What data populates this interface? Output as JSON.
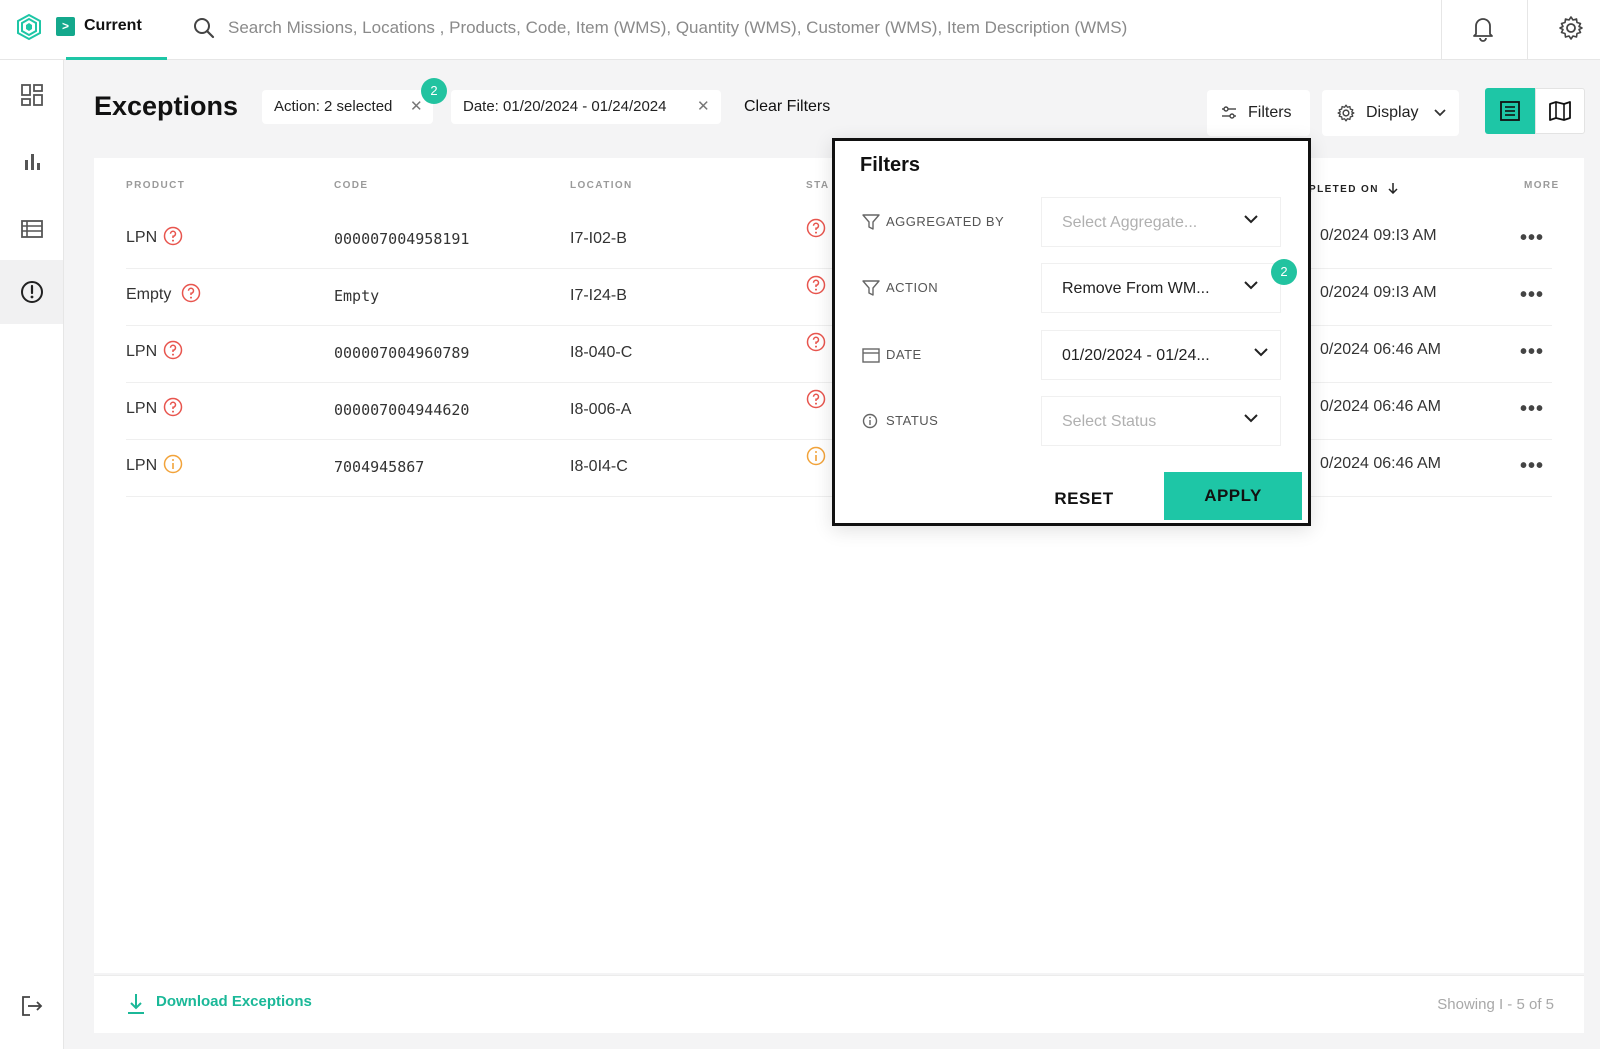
{
  "topbar": {
    "current_tab": "Current",
    "search_placeholder": "Search Missions, Locations , Products, Code, Item (WMS), Quantity (WMS), Customer (WMS), Item Description (WMS)"
  },
  "sidebar": {
    "items": [
      {
        "name": "dashboard",
        "icon": "grid-icon"
      },
      {
        "name": "analytics",
        "icon": "bar-chart-icon"
      },
      {
        "name": "list",
        "icon": "table-icon"
      },
      {
        "name": "exceptions",
        "icon": "alert-circle-icon",
        "active": true
      }
    ],
    "bottom_icon": "logout-icon"
  },
  "page": {
    "title": "Exceptions",
    "chips": [
      {
        "label": "Action: 2 selected",
        "badge": "2"
      },
      {
        "label": "Date: 01/20/2024 - 01/24/2024"
      }
    ],
    "clear_filters": "Clear Filters",
    "filters_button": "Filters",
    "display_button": "Display"
  },
  "table": {
    "columns": {
      "product": "PRODUCT",
      "code": "CODE",
      "location": "LOCATION",
      "status": "STA",
      "completed_on": "PLETED ON",
      "more": "MORE"
    },
    "rows": [
      {
        "product": "LPN",
        "code": "000007004958191",
        "location": "I7-I02-B",
        "status_kind": "question",
        "completed": "0/2024 09:I3 AM"
      },
      {
        "product": "Empty",
        "code": "Empty",
        "location": "I7-I24-B",
        "status_kind": "question",
        "completed": "0/2024 09:I3 AM"
      },
      {
        "product": "LPN",
        "code": "000007004960789",
        "location": "I8-040-C",
        "status_kind": "question",
        "completed": "0/2024 06:46 AM"
      },
      {
        "product": "LPN",
        "code": "000007004944620",
        "location": "I8-006-A",
        "status_kind": "question",
        "completed": "0/2024 06:46 AM"
      },
      {
        "product": "LPN",
        "code": "7004945867",
        "location": "I8-0I4-C",
        "status_kind": "info",
        "completed": "0/2024 06:46 AM"
      }
    ],
    "more_glyph": "•••"
  },
  "footer": {
    "download": "Download Exceptions",
    "showing": "Showing I - 5 of 5"
  },
  "filters_popup": {
    "title": "Filters",
    "aggregated_by": {
      "label": "AGGREGATED BY",
      "value": "Select Aggregate..."
    },
    "action": {
      "label": "ACTION",
      "value": "Remove From WM...",
      "badge": "2"
    },
    "date": {
      "label": "DATE",
      "value": "01/20/2024 - 01/24..."
    },
    "status": {
      "label": "STATUS",
      "value": "Select Status"
    },
    "reset": "RESET",
    "apply": "APPLY"
  },
  "colors": {
    "accent": "#1ec6a6",
    "question_status": "#e8554e",
    "info_status": "#f2a33a"
  }
}
